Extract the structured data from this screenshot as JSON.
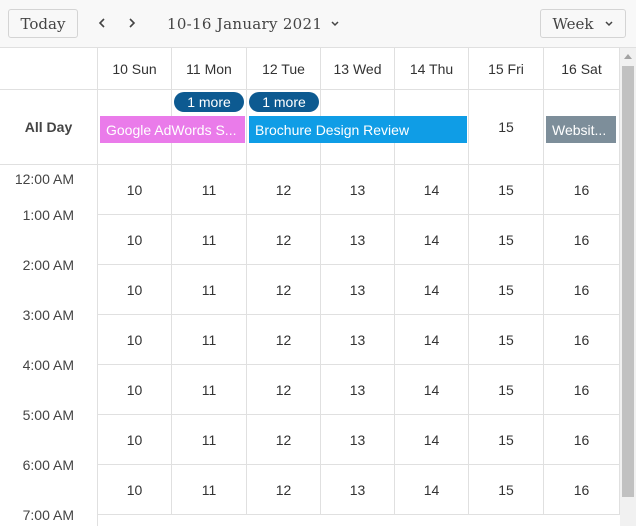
{
  "toolbar": {
    "today_label": "Today",
    "date_range": "10-16 January 2021",
    "view_label": "Week"
  },
  "icons": {
    "prev": "chevron-left-icon",
    "next": "chevron-right-icon",
    "date_dropdown": "chevron-down-icon",
    "view_dropdown": "chevron-down-icon"
  },
  "days": [
    {
      "label": "10 Sun",
      "num": "10"
    },
    {
      "label": "11 Mon",
      "num": "11"
    },
    {
      "label": "12 Tue",
      "num": "12"
    },
    {
      "label": "13 Wed",
      "num": "13"
    },
    {
      "label": "14 Thu",
      "num": "14"
    },
    {
      "label": "15 Fri",
      "num": "15"
    },
    {
      "label": "16 Sat",
      "num": "16"
    }
  ],
  "allday": {
    "label": "All Day",
    "fri_num": "15",
    "more_mon": "1 more",
    "more_tue": "1 more",
    "events": [
      {
        "title": "Google AdWords S...",
        "color": "#ea7bea"
      },
      {
        "title": "Brochure Design Review",
        "color": "#0f9de6"
      },
      {
        "title": "Websit...",
        "color": "#7d8e9a"
      }
    ]
  },
  "times": [
    "12:00 AM",
    "1:00 AM",
    "2:00 AM",
    "3:00 AM",
    "4:00 AM",
    "5:00 AM",
    "6:00 AM",
    "7:00 AM"
  ]
}
